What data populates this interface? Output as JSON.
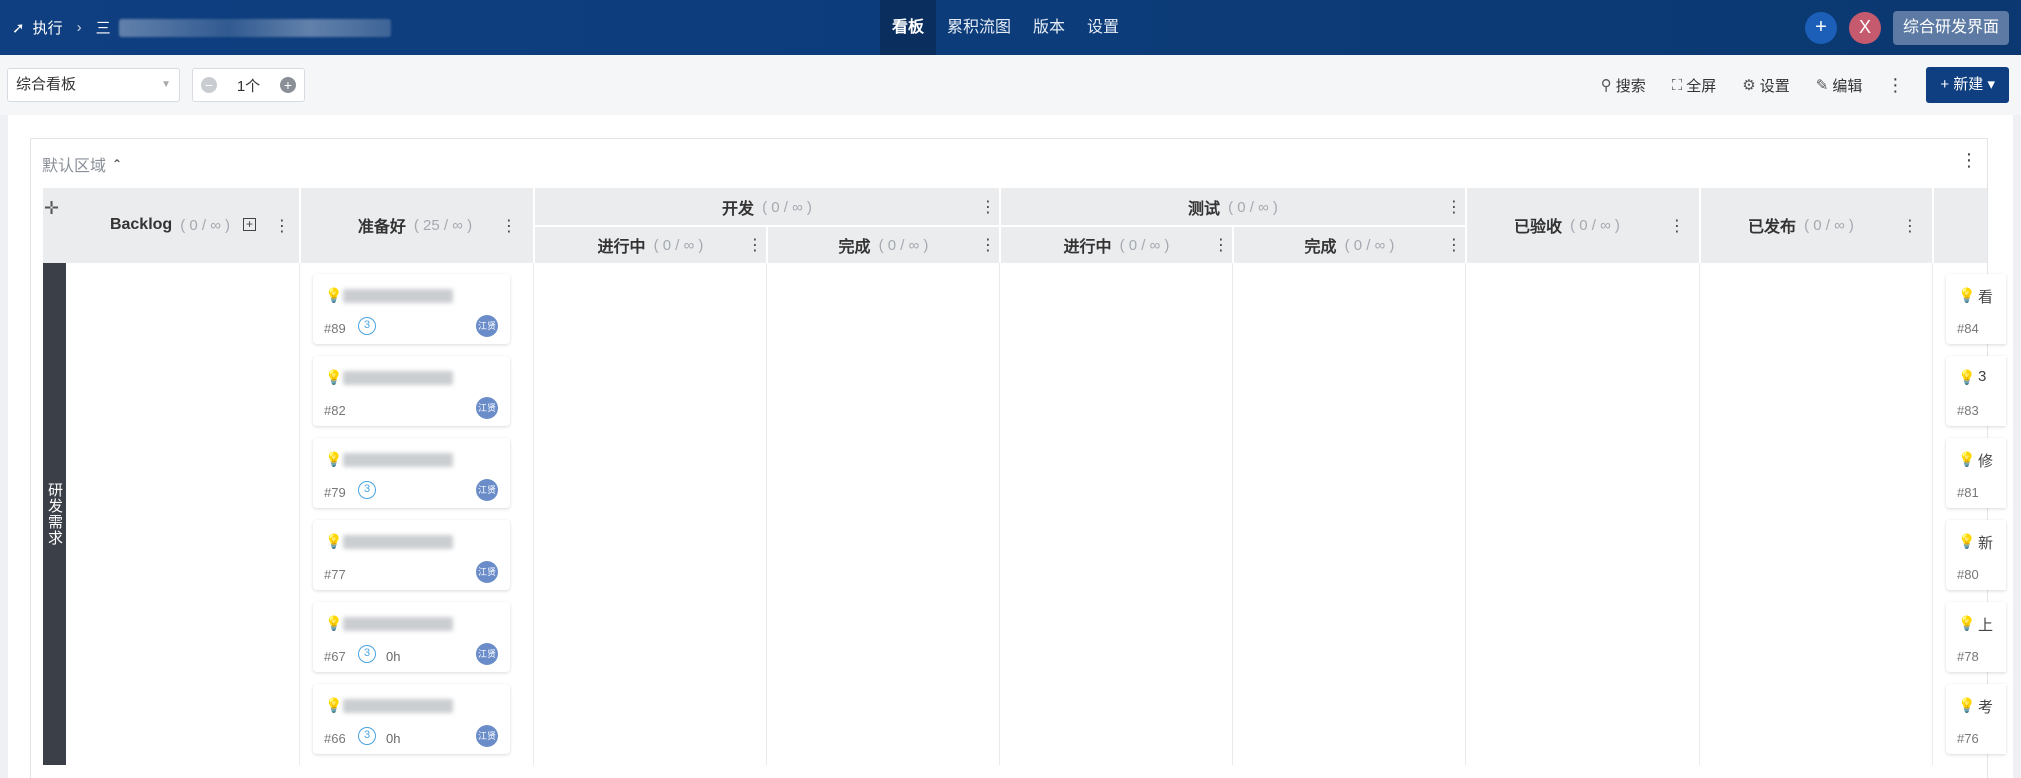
{
  "topbar": {
    "execute_label": "执行",
    "project_name_prefix": "三",
    "nav": [
      "看板",
      "累积流图",
      "版本",
      "设置"
    ],
    "active_nav": "看板",
    "avatar_letter": "X",
    "workspace_button": "综合研发界面"
  },
  "toolbar": {
    "board_select_value": "综合看板",
    "stepper_value": "1个",
    "search_label": "搜索",
    "fullscreen_label": "全屏",
    "settings_label": "设置",
    "edit_label": "编辑",
    "new_label": "新建"
  },
  "region": {
    "title": "默认区域"
  },
  "columns": {
    "backlog": {
      "name": "Backlog",
      "wip": "( 0 / ∞ )"
    },
    "ready": {
      "name": "准备好",
      "wip": "( 25 / ∞ )"
    },
    "dev": {
      "name": "开发",
      "wip": "( 0 / ∞ )"
    },
    "dev_doing": {
      "name": "进行中",
      "wip": "( 0 / ∞ )"
    },
    "dev_done": {
      "name": "完成",
      "wip": "( 0 / ∞ )"
    },
    "test": {
      "name": "测试",
      "wip": "( 0 / ∞ )"
    },
    "test_doing": {
      "name": "进行中",
      "wip": "( 0 / ∞ )"
    },
    "test_done": {
      "name": "完成",
      "wip": "( 0 / ∞ )"
    },
    "accepted": {
      "name": "已验收",
      "wip": "( 0 / ∞ )"
    },
    "released": {
      "name": "已发布",
      "wip": "( 0 / ∞ )"
    }
  },
  "swimlane": {
    "label": "研发需求"
  },
  "cards": [
    {
      "title": "...示...",
      "id": "#89",
      "estimate": "3",
      "hours": "",
      "assignee": "江贤"
    },
    {
      "title": "...员...",
      "id": "#82",
      "estimate": "",
      "hours": "",
      "assignee": "江贤"
    },
    {
      "title": "...示...",
      "id": "#79",
      "estimate": "3",
      "hours": "",
      "assignee": "江贤"
    },
    {
      "title": "...理...",
      "id": "#77",
      "estimate": "",
      "hours": "",
      "assignee": "江贤"
    },
    {
      "title": "...件...",
      "id": "#67",
      "estimate": "3",
      "hours": "0h",
      "assignee": "江贤"
    },
    {
      "title": "C...库...",
      "id": "#66",
      "estimate": "3",
      "hours": "0h",
      "assignee": "江贤"
    }
  ],
  "right_cards": [
    {
      "char": "看",
      "id": "#84"
    },
    {
      "char": "3",
      "id": "#83"
    },
    {
      "char": "修",
      "id": "#81"
    },
    {
      "char": "新",
      "id": "#80"
    },
    {
      "char": "上",
      "id": "#78"
    },
    {
      "char": "考",
      "id": "#76"
    }
  ]
}
